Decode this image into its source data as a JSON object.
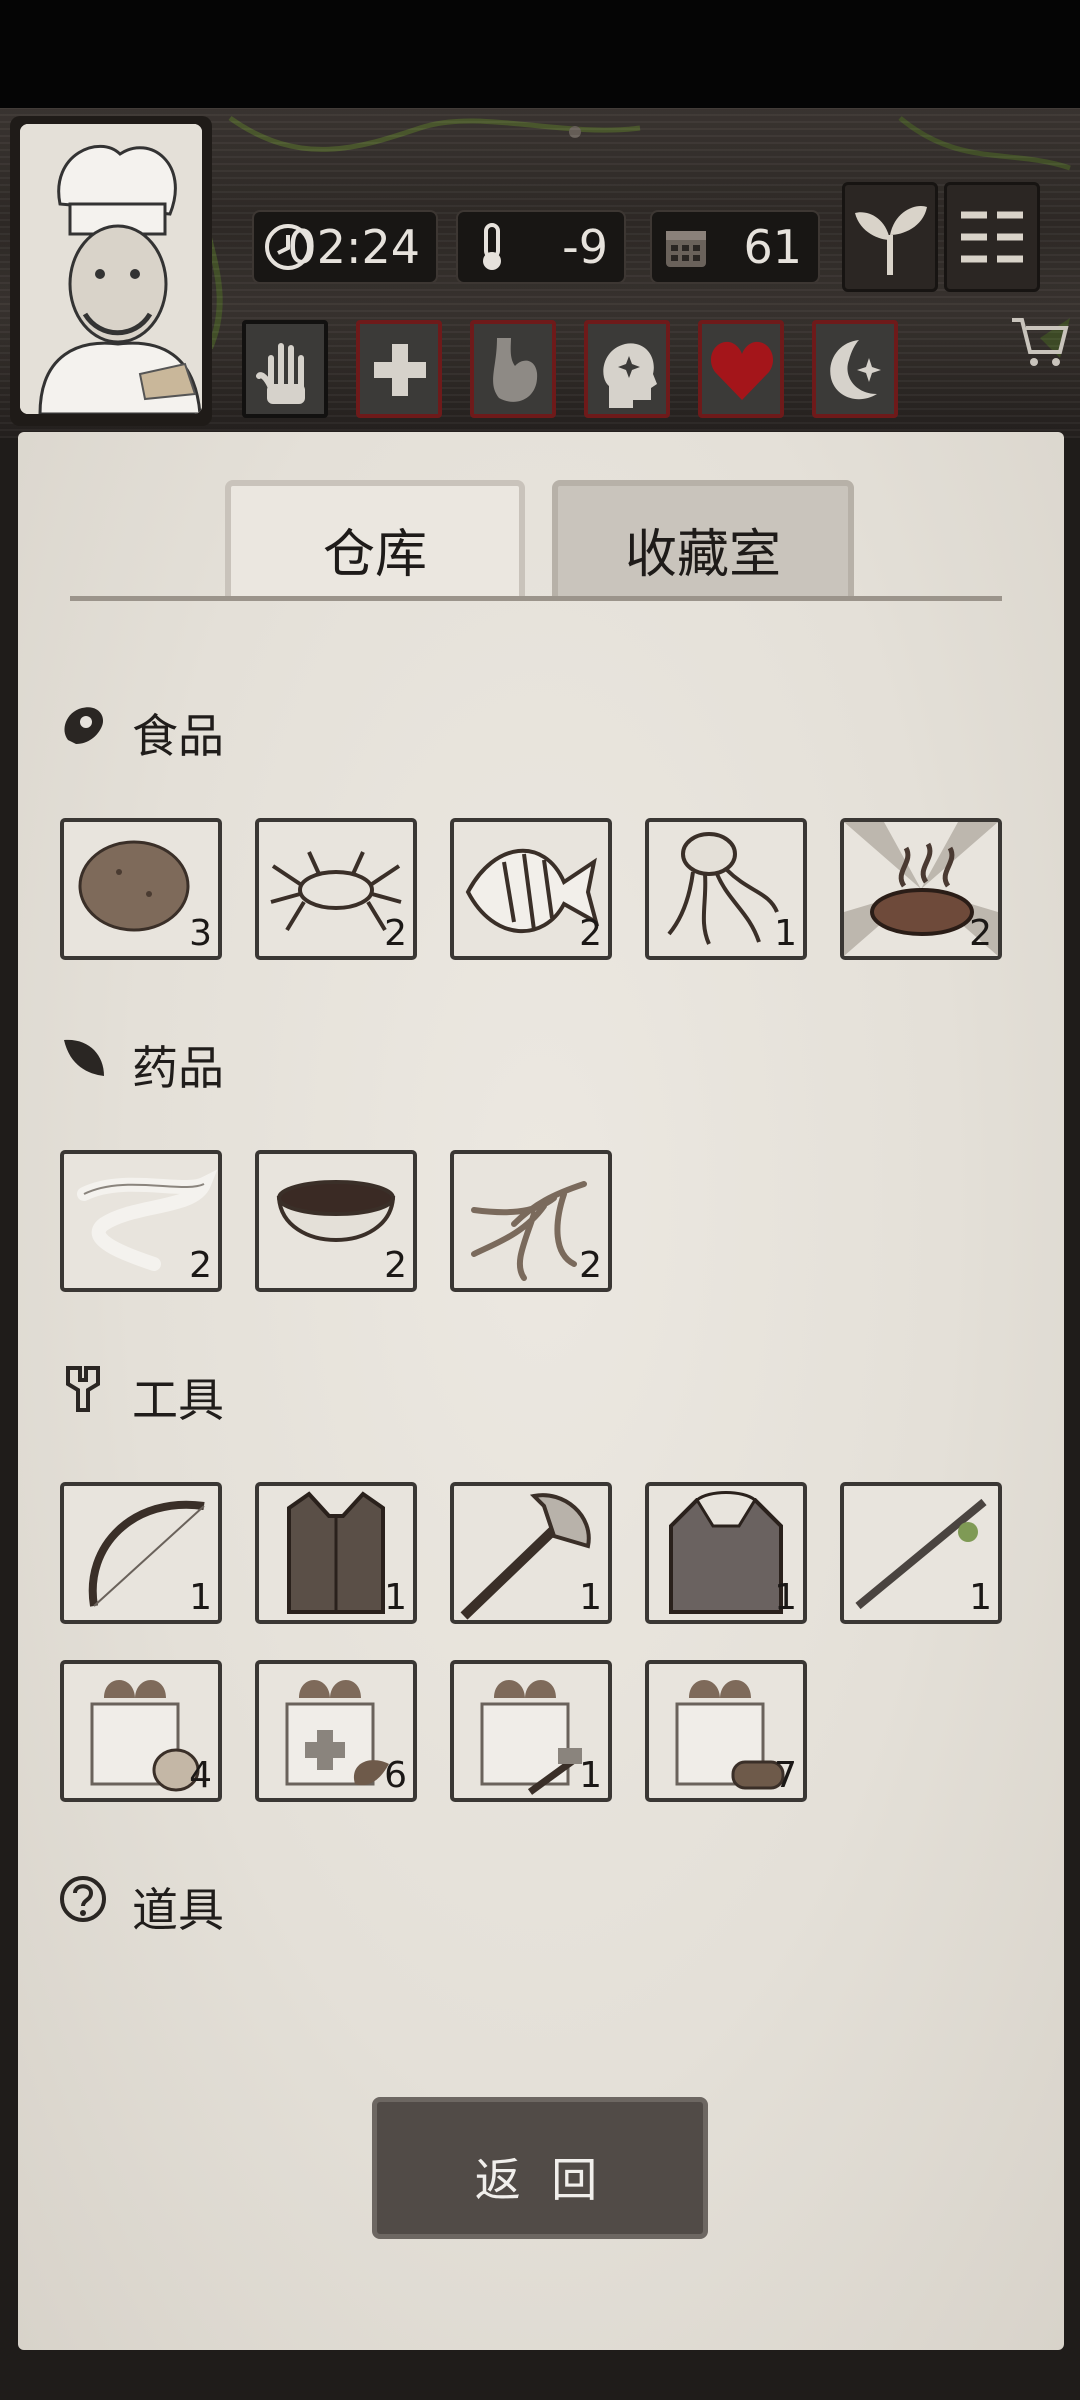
{
  "status": {
    "time": "02:24",
    "temperature": "-9",
    "day": "61"
  },
  "tabs": [
    {
      "label": "仓库",
      "active": true
    },
    {
      "label": "收藏室",
      "active": false
    }
  ],
  "sections": {
    "food": {
      "title": "食品",
      "items": [
        {
          "name": "potato",
          "count": "3"
        },
        {
          "name": "crab",
          "count": "2"
        },
        {
          "name": "fish",
          "count": "2"
        },
        {
          "name": "jellyfish",
          "count": "1"
        },
        {
          "name": "grilled-steak",
          "count": "2"
        }
      ]
    },
    "medicine": {
      "title": "药品",
      "items": [
        {
          "name": "bandage",
          "count": "2"
        },
        {
          "name": "herbal-soup",
          "count": "2"
        },
        {
          "name": "ginseng",
          "count": "2"
        }
      ]
    },
    "tools": {
      "title": "工具",
      "items": [
        {
          "name": "bow",
          "count": "1"
        },
        {
          "name": "vest",
          "count": "1"
        },
        {
          "name": "axe",
          "count": "1"
        },
        {
          "name": "fur-coat",
          "count": "1"
        },
        {
          "name": "spear",
          "count": "1"
        },
        {
          "name": "food-gift-box",
          "count": "4"
        },
        {
          "name": "medicine-gift-box",
          "count": "6"
        },
        {
          "name": "tool-gift-box",
          "count": "1"
        },
        {
          "name": "wood-gift-box",
          "count": "7"
        }
      ]
    },
    "props": {
      "title": "道具",
      "items": []
    }
  },
  "back_button": "返 回"
}
